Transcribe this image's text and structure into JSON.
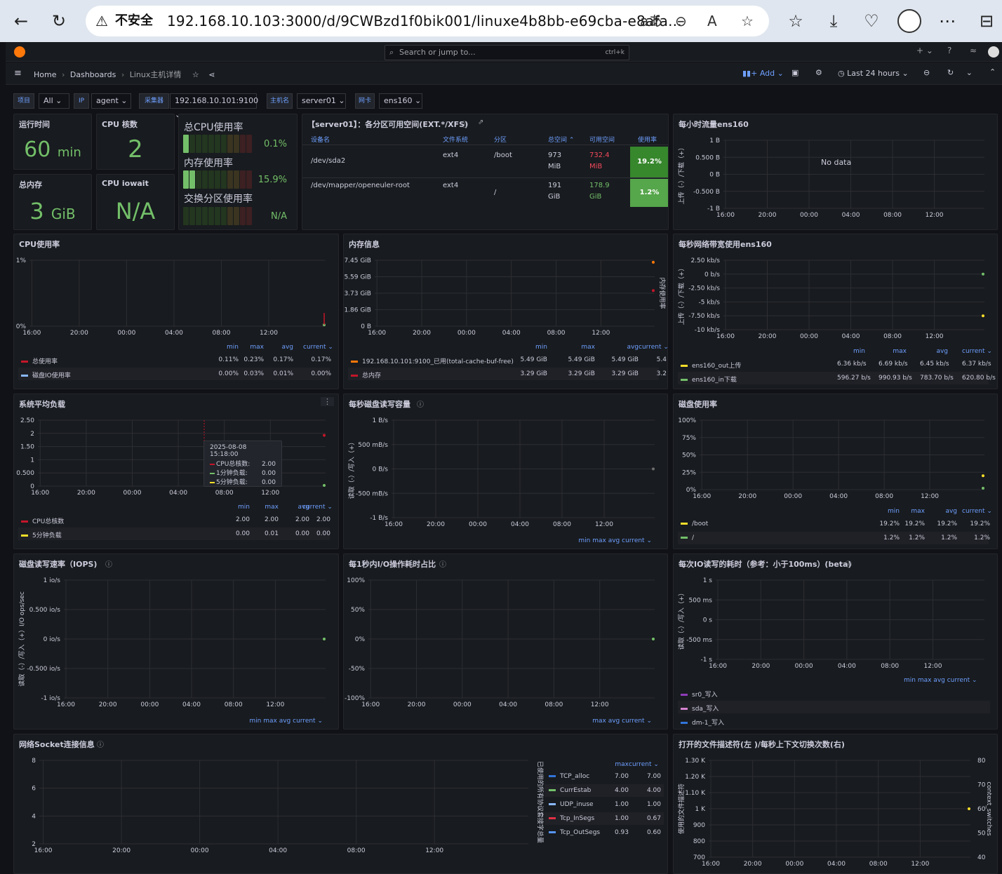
{
  "browser": {
    "not_secure": "不安全",
    "url": "192.168.10.103:3000/d/9CWBzd1f0bik001/linuxe4b8bb-e69cba-e8afa...",
    "reader_icon": "aあ"
  },
  "grafana": {
    "search_placeholder": "Search or jump to...",
    "search_shortcut": "ctrl+k",
    "breadcrumb": [
      "Home",
      "Dashboards",
      "Linux主机详情"
    ],
    "add_label": "Add",
    "time_range": "Last 24 hours"
  },
  "variables": [
    {
      "label": "项目",
      "value": "All"
    },
    {
      "label": "IP",
      "value": "agent"
    },
    {
      "label": "采集器",
      "value": "192.168.10.101:9100"
    },
    {
      "label": "主机名",
      "value": "server01"
    },
    {
      "label": "网卡",
      "value": "ens160"
    }
  ],
  "stats": {
    "uptime": {
      "title": "运行时间",
      "value": "60",
      "unit": "min"
    },
    "cpu_cores": {
      "title": "CPU 核数",
      "value": "2"
    },
    "total_mem": {
      "title": "总内存",
      "value": "3",
      "unit": "GiB"
    },
    "cpu_iowait": {
      "title": "CPU iowait",
      "value": "N/A"
    }
  },
  "gauges": [
    {
      "title": "总CPU使用率",
      "value": "0.1%",
      "fraction": 0.001
    },
    {
      "title": "内存使用率",
      "value": "15.9%",
      "fraction": 0.159
    },
    {
      "title": "交换分区使用率",
      "value": "N/A",
      "fraction": 0
    }
  ],
  "disk_table": {
    "title": "【server01】：各分区可用空间(EXT.*/XFS)",
    "headers": [
      "设备名",
      "文件系统",
      "分区",
      "总空间",
      "可用空间",
      "使用率"
    ],
    "rows": [
      {
        "device": "/dev/sda2",
        "fs": "ext4",
        "mount": "/boot",
        "total": "973",
        "total_unit": "MiB",
        "avail": "732.4",
        "avail_unit": "MiB",
        "usage": "19.2%"
      },
      {
        "device": "/dev/mapper/openeuler-root",
        "fs": "ext4",
        "mount": "/",
        "total": "191",
        "total_unit": "GiB",
        "avail": "178.9",
        "avail_unit": "GiB",
        "usage": "1.2%"
      }
    ]
  },
  "hourly_traffic": {
    "title": "每小时流量ens160",
    "no_data": "No data",
    "yticks": [
      "1 B",
      "0.500 B",
      "0 B",
      "-0.500 B",
      "-1 B"
    ],
    "ylabel": "上传（-）/下载（+）"
  },
  "time_ticks": [
    "16:00",
    "20:00",
    "00:00",
    "04:00",
    "08:00",
    "12:00"
  ],
  "legend_hdr": {
    "min": "min",
    "max": "max",
    "avg": "avg",
    "current": "current"
  },
  "cpu_usage": {
    "title": "CPU使用率",
    "yticks": [
      "1%",
      "0%"
    ],
    "series": [
      {
        "name": "总使用率",
        "color": "#c4162a",
        "min": "0.11%",
        "max": "0.23%",
        "avg": "0.17%",
        "current": "0.17%"
      },
      {
        "name": "磁盘IO使用率",
        "color": "#8ab8ff",
        "min": "0.00%",
        "max": "0.03%",
        "avg": "0.01%",
        "current": "0.00%"
      }
    ]
  },
  "mem_info": {
    "title": "内存信息",
    "yticks": [
      "7.45 GiB",
      "5.59 GiB",
      "3.73 GiB",
      "1.86 GiB",
      "0 B"
    ],
    "right_label": "内存使用率",
    "series": [
      {
        "name": "192.168.10.101:9100_已用(total-cache-buf-free)",
        "color": "#ff780a",
        "min": "5.49 GiB",
        "max": "5.49 GiB",
        "avg": "5.49 GiB",
        "current": "5.4"
      },
      {
        "name": "总内存",
        "color": "#c4162a",
        "min": "3.29 GiB",
        "max": "3.29 GiB",
        "avg": "3.29 GiB",
        "current": "3.2"
      }
    ]
  },
  "net_bw": {
    "title": "每秒网络带宽使用ens160",
    "yticks": [
      "2.50 kb/s",
      "0 b/s",
      "-2.50 kb/s",
      "-5 kb/s",
      "-7.50 kb/s",
      "-10 kb/s"
    ],
    "ylabel": "上传（-）/下载（+）",
    "series": [
      {
        "name": "ens160_out上传",
        "color": "#fade2a",
        "min": "6.36 kb/s",
        "max": "6.69 kb/s",
        "avg": "6.45 kb/s",
        "current": "6.37 kb/s"
      },
      {
        "name": "ens160_in下载",
        "color": "#73bf69",
        "min": "596.27 b/s",
        "max": "990.93 b/s",
        "avg": "783.70 b/s",
        "current": "620.80 b/s"
      }
    ]
  },
  "load_avg": {
    "title": "系统平均负载",
    "yticks": [
      "2.50",
      "2",
      "1.50",
      "1",
      "0.500",
      "0"
    ],
    "tooltip": {
      "time": "2025-08-08 15:18:00",
      "rows": [
        {
          "name": "CPU总核数:",
          "value": "2.00",
          "color": "#c4162a"
        },
        {
          "name": "1分钟负载:",
          "value": "0.00",
          "color": "#73bf69"
        },
        {
          "name": "5分钟负载:",
          "value": "0.00",
          "color": "#fade2a"
        }
      ]
    },
    "series": [
      {
        "name": "CPU总核数",
        "color": "#c4162a",
        "min": "2.00",
        "max": "2.00",
        "avg": "2.00",
        "current": "2.00"
      },
      {
        "name": "5分钟负载",
        "color": "#fade2a",
        "min": "0.00",
        "max": "0.01",
        "avg": "0.00",
        "current": "0.00"
      }
    ]
  },
  "disk_rw": {
    "title": "每秒磁盘读写容量",
    "yticks": [
      "1 B/s",
      "500 mB/s",
      "0 B/s",
      "-500 mB/s",
      "-1 B/s"
    ],
    "ylabel": "读取（-）/写入（+）"
  },
  "disk_usage": {
    "title": "磁盘使用率",
    "yticks": [
      "100%",
      "75%",
      "50%",
      "25%",
      "0%"
    ],
    "series": [
      {
        "name": "/boot",
        "color": "#fade2a",
        "min": "19.2%",
        "max": "19.2%",
        "avg": "19.2%",
        "current": "19.2%"
      },
      {
        "name": "/",
        "color": "#73bf69",
        "min": "1.2%",
        "max": "1.2%",
        "avg": "1.2%",
        "current": "1.2%"
      }
    ]
  },
  "iops": {
    "title": "磁盘读写速率（IOPS)",
    "yticks": [
      "1 io/s",
      "0.500 io/s",
      "0 io/s",
      "-0.500 io/s",
      "-1 io/s"
    ],
    "ylabel": "读取（-）/写入（+）I/O ops/sec"
  },
  "io_time": {
    "title": "每1秒内I/O操作耗时占比",
    "yticks": [
      "100%",
      "50%",
      "0%",
      "-50%",
      "-100%"
    ]
  },
  "io_latency": {
    "title": "每次IO读写的耗时（参考：小于100ms）(beta)",
    "yticks": [
      "1 s",
      "500 ms",
      "0 s",
      "-500 ms",
      "-1 s"
    ],
    "ylabel": "读取（-）/写入（+）",
    "series": [
      {
        "name": "sr0_写入",
        "color": "#8f3bb8"
      },
      {
        "name": "sda_写入",
        "color": "#d683ce"
      },
      {
        "name": "dm-1_写入",
        "color": "#3274d9"
      }
    ]
  },
  "socket": {
    "title": "网络Socket连接信息",
    "yticks": [
      "8",
      "6",
      "4",
      "2"
    ],
    "right_label": "已使用的所有协议套接字总量",
    "series": [
      {
        "name": "TCP_alloc",
        "color": "#3274d9",
        "max": "7.00",
        "current": "7.00"
      },
      {
        "name": "CurrEstab",
        "color": "#73bf69",
        "max": "4.00",
        "current": "4.00"
      },
      {
        "name": "UDP_inuse",
        "color": "#8ab8ff",
        "max": "1.00",
        "current": "1.00"
      },
      {
        "name": "Tcp_InSegs",
        "color": "#e02f44",
        "max": "1.00",
        "current": "0.67"
      },
      {
        "name": "Tcp_OutSegs",
        "color": "#5794f2",
        "max": "0.93",
        "current": "0.60"
      }
    ]
  },
  "fd": {
    "title": "打开的文件描述符(左 )/每秒上下文切换次数(右)",
    "yticks": [
      "1.30 K",
      "1.20 K",
      "1.10 K",
      "1 K",
      "900",
      "800",
      "700"
    ],
    "yticks_right": [
      "80",
      "70",
      "60",
      "50",
      "40"
    ],
    "ylabel": "使用的文件描述符",
    "ylabel_right": "context_switches"
  }
}
